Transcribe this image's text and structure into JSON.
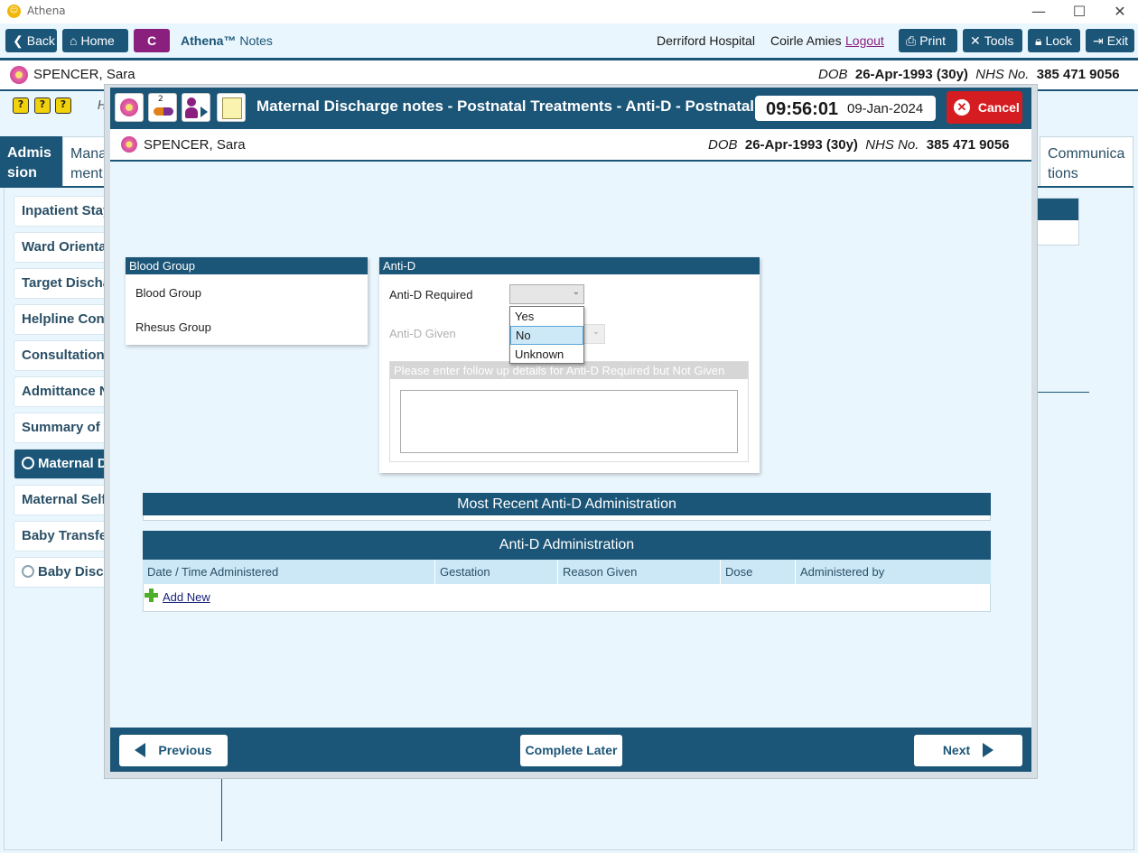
{
  "window": {
    "title": "Athena",
    "controls": [
      "—",
      "☐",
      "✕"
    ]
  },
  "toolbar": {
    "back": "Back",
    "home": "Home",
    "c": "C",
    "app_brand": "Athena™",
    "app_module": "Notes",
    "hospital": "Derriford Hospital",
    "user": "Coirle Amies",
    "logout": "Logout",
    "print": "Print",
    "tools": "Tools",
    "lock": "Lock",
    "exit": "Exit"
  },
  "patient": {
    "name": "SPENCER, Sara",
    "dob_label": "DOB",
    "dob": "26-Apr-1993 (30y)",
    "nhs_label": "NHS No.",
    "nhs": "385 471 9056"
  },
  "background": {
    "tabs": {
      "admission": "Admis sion",
      "management": "Mana ment",
      "communications": "Communica tions"
    },
    "helper_letter": "H",
    "nav": [
      {
        "label": "Inpatient Stay",
        "radio": false,
        "active": false
      },
      {
        "label": "Ward Orientat",
        "radio": false,
        "active": false
      },
      {
        "label": "Target Dischar",
        "radio": false,
        "active": false
      },
      {
        "label": "Helpline Cont",
        "radio": false,
        "active": false
      },
      {
        "label": "Consultation I",
        "radio": false,
        "active": false
      },
      {
        "label": "Admittance N",
        "radio": false,
        "active": false
      },
      {
        "label": "Summary of P",
        "radio": false,
        "active": false
      },
      {
        "label": "Maternal Di",
        "radio": true,
        "active": true
      },
      {
        "label": "Maternal Self",
        "radio": false,
        "active": false
      },
      {
        "label": "Baby Transfer",
        "radio": false,
        "active": false
      },
      {
        "label": "Baby Discha",
        "radio": true,
        "active": false
      }
    ]
  },
  "modal": {
    "title": "Maternal Discharge notes - Postnatal Treatments - Anti-D - Postnatal Treatments",
    "time": "09:56:01",
    "date": "09-Jan-2024",
    "cancel": "Cancel",
    "icon_badge": "2",
    "blood_panel": {
      "title": "Blood Group",
      "blood_group_label": "Blood Group",
      "rhesus_label": "Rhesus Group"
    },
    "antid_panel": {
      "title": "Anti-D",
      "required_label": "Anti-D Required",
      "required_value": "",
      "given_label": "Anti-D Given",
      "dropdown_options": [
        "Yes",
        "No",
        "Unknown"
      ],
      "highlighted_option": "No",
      "followup_label": "Please enter follow up details for Anti-D Required but Not Given",
      "followup_value": ""
    },
    "recent_section": "Most Recent Anti-D Administration",
    "admin_section": {
      "title": "Anti-D Administration",
      "columns": [
        "Date / Time Administered",
        "Gestation",
        "Reason Given",
        "Dose",
        "Administered by"
      ],
      "add_new": "Add New"
    },
    "footer": {
      "previous": "Previous",
      "complete_later": "Complete Later",
      "next": "Next"
    }
  }
}
